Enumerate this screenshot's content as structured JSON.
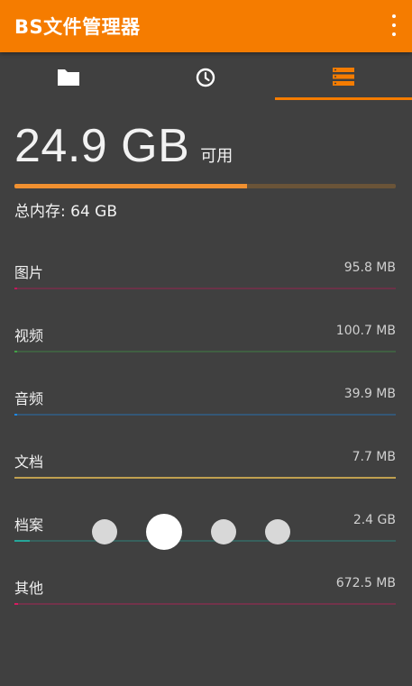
{
  "app": {
    "title": "BS文件管理器",
    "accent_color": "#f57c00"
  },
  "tabs": [
    {
      "icon": "folder-icon",
      "selected": false
    },
    {
      "icon": "clock-icon",
      "selected": false
    },
    {
      "icon": "storage-list-icon",
      "selected": true
    }
  ],
  "storage": {
    "available_value": "24.9 GB",
    "available_label": "可用",
    "used_fraction": 0.61,
    "total_text": "总内存: 64 GB"
  },
  "categories": [
    {
      "name": "图片",
      "size": "95.8 MB",
      "color": "#c2185b",
      "fraction": 0.005
    },
    {
      "name": "视频",
      "size": "100.7 MB",
      "color": "#43a047",
      "fraction": 0.006
    },
    {
      "name": "音频",
      "size": "39.9 MB",
      "color": "#1e88e5",
      "fraction": 0.003
    },
    {
      "name": "文档",
      "size": "7.7 MB",
      "color": "#c0a050",
      "fraction": 1.0
    },
    {
      "name": "档案",
      "size": "2.4 GB",
      "color": "#26a69a",
      "fraction": 0.04
    },
    {
      "name": "其他",
      "size": "672.5 MB",
      "color": "#d81b60",
      "fraction": 0.01
    }
  ],
  "page_indicator": {
    "count": 4,
    "active_index": 1
  }
}
